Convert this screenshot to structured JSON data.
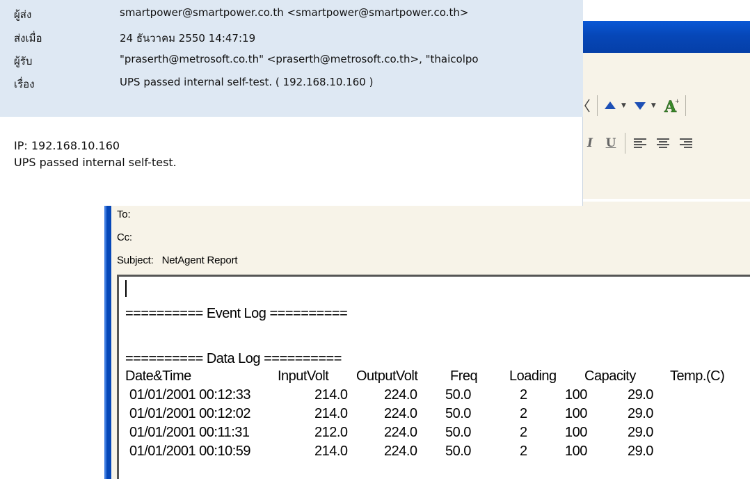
{
  "notification": {
    "fields": [
      {
        "label": "ผู้ส่ง",
        "value": "smartpower@smartpower.co.th <smartpower@smartpower.co.th>"
      },
      {
        "label": "ส่งเมื่อ",
        "value": "24 ธันวาคม 2550 14:47:19"
      },
      {
        "label": "ผู้รับ",
        "value": "\"praserth@metrosoft.co.th\" <praserth@metrosoft.co.th>, \"thaicolpo"
      },
      {
        "label": "เรื่อง",
        "value": "UPS passed internal self-test. ( 192.168.10.160 )"
      }
    ],
    "body": [
      "IP: 192.168.10.160",
      "UPS passed internal self-test."
    ]
  },
  "compose": {
    "to_label": "To:",
    "cc_label": "Cc:",
    "subject_label": "Subject:",
    "subject_value": "NetAgent Report",
    "toolbar_icons": [
      "indent-chevron-icon",
      "arrow-up-priority-icon",
      "arrow-down-priority-icon",
      "font-style-icon",
      "italic-icon",
      "underline-icon",
      "align-left-icon",
      "align-center-icon",
      "align-right-icon"
    ],
    "toolbar_glyphs": {
      "italic": "I",
      "underline": "U"
    },
    "event_log_header": "========== Event Log ==========",
    "data_log_header": "========== Data Log ==========",
    "columns": [
      "Date&Time",
      "InputVolt",
      "OutputVolt",
      "Freq",
      "Loading",
      "Capacity",
      "Temp.(C)"
    ],
    "rows": [
      [
        "01/01/2001 00:12:33",
        "214.0",
        "224.0",
        "50.0",
        "2",
        "100",
        "29.0"
      ],
      [
        "01/01/2001 00:12:02",
        "214.0",
        "224.0",
        "50.0",
        "2",
        "100",
        "29.0"
      ],
      [
        "01/01/2001 00:11:31",
        "212.0",
        "224.0",
        "50.0",
        "2",
        "100",
        "29.0"
      ],
      [
        "01/01/2001 00:10:59",
        "214.0",
        "224.0",
        "50.0",
        "2",
        "100",
        "29.0"
      ]
    ]
  },
  "colors": {
    "titlebar": "#0647b8",
    "popup_header": "#dee8f3",
    "compose_bg": "#f7f3e8"
  }
}
